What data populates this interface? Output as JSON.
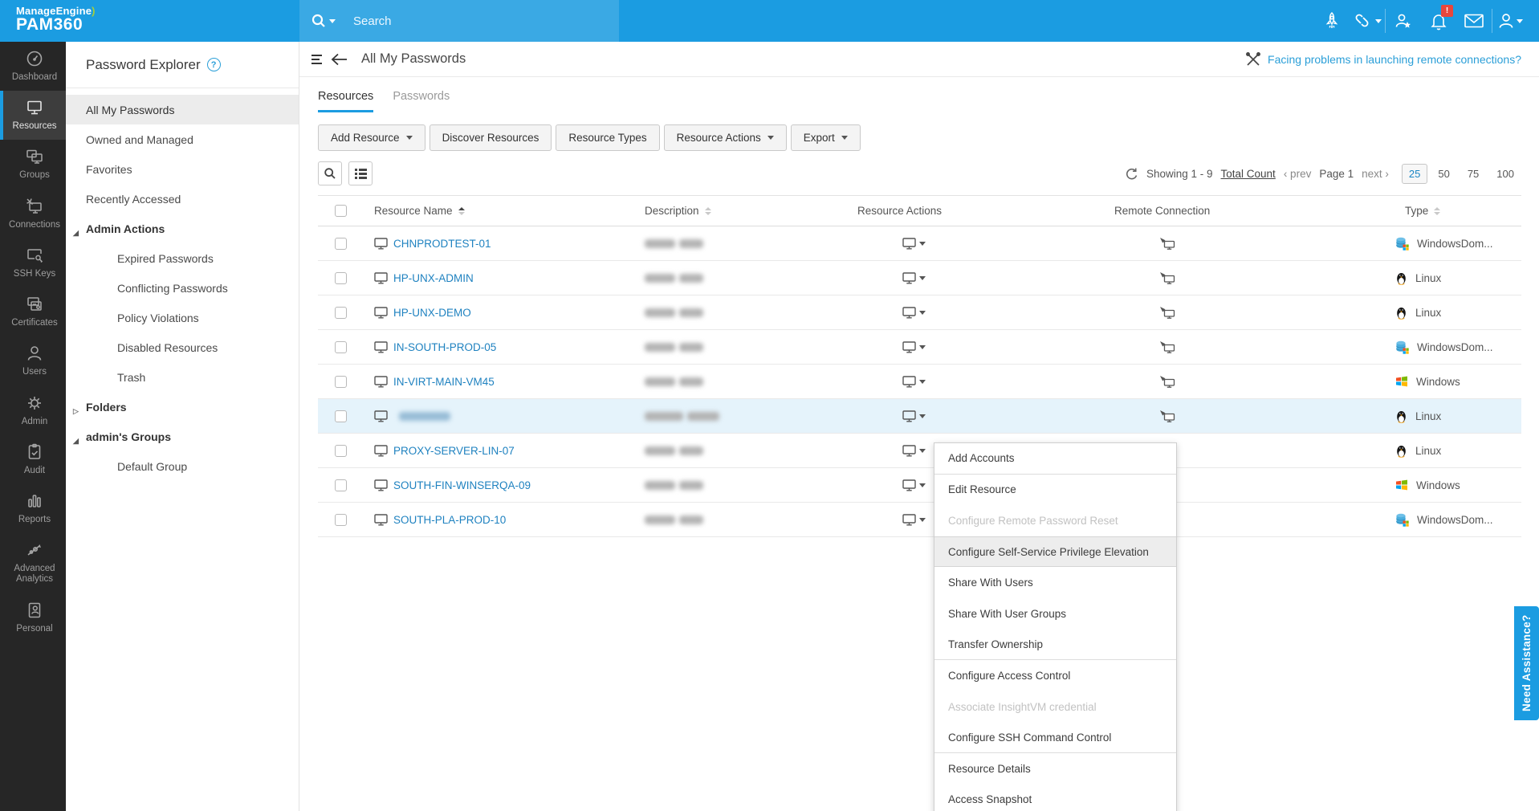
{
  "topbar": {
    "brand_line1": "ManageEngine",
    "brand_swoosh": ")",
    "brand_line2": "PAM360",
    "search_placeholder": "Search",
    "notification_badge": "!"
  },
  "sidebar": {
    "items": [
      {
        "label": "Dashboard",
        "icon": "nav-dashboard"
      },
      {
        "label": "Resources",
        "icon": "nav-resources",
        "active": true
      },
      {
        "label": "Groups",
        "icon": "nav-groups"
      },
      {
        "label": "Connections",
        "icon": "nav-connections"
      },
      {
        "label": "SSH Keys",
        "icon": "nav-sshkeys"
      },
      {
        "label": "Certificates",
        "icon": "nav-certificates"
      },
      {
        "label": "Users",
        "icon": "nav-users"
      },
      {
        "label": "Admin",
        "icon": "nav-admin"
      },
      {
        "label": "Audit",
        "icon": "nav-audit"
      },
      {
        "label": "Reports",
        "icon": "nav-reports"
      },
      {
        "label": "Advanced Analytics",
        "icon": "nav-analytics"
      },
      {
        "label": "Personal",
        "icon": "nav-personal"
      }
    ]
  },
  "explorer": {
    "title": "Password Explorer",
    "help": "?",
    "items": [
      {
        "label": "All My Passwords",
        "selected": true
      },
      {
        "label": "Owned and Managed"
      },
      {
        "label": "Favorites"
      },
      {
        "label": "Recently Accessed"
      },
      {
        "label": "Admin Actions",
        "group": true,
        "marker": "expanded"
      },
      {
        "label": "Expired Passwords",
        "indent": true
      },
      {
        "label": "Conflicting Passwords",
        "indent": true
      },
      {
        "label": "Policy Violations",
        "indent": true
      },
      {
        "label": "Disabled Resources",
        "indent": true
      },
      {
        "label": "Trash",
        "indent": true
      },
      {
        "label": "Folders",
        "group": true,
        "marker": "collapsed"
      },
      {
        "label": "admin's Groups",
        "group": true,
        "marker": "expanded"
      },
      {
        "label": "Default Group",
        "indent": true
      }
    ]
  },
  "header": {
    "title": "All My Passwords",
    "help_link": "Facing problems in launching remote connections?"
  },
  "tabs": {
    "resources": "Resources",
    "passwords": "Passwords"
  },
  "toolbar": {
    "add_resource": "Add Resource",
    "discover": "Discover Resources",
    "resource_types": "Resource Types",
    "resource_actions": "Resource Actions",
    "export": "Export"
  },
  "pagination": {
    "showing": "Showing 1 - 9",
    "total_count": "Total Count",
    "prev": "‹ prev",
    "page": "Page 1",
    "next": "next ›",
    "sizes": [
      {
        "label": "25",
        "active": true
      },
      {
        "label": "50"
      },
      {
        "label": "75"
      },
      {
        "label": "100"
      }
    ]
  },
  "table": {
    "columns": {
      "name": "Resource Name",
      "description": "Description",
      "actions": "Resource Actions",
      "remote": "Remote Connection",
      "type": "Type"
    },
    "rows": [
      {
        "name": "CHNPRODTEST-01",
        "os": "WindowsDom...",
        "os_icon": "windows-domain"
      },
      {
        "name": "HP-UNX-ADMIN",
        "os": "Linux",
        "os_icon": "linux"
      },
      {
        "name": "HP-UNX-DEMO",
        "os": "Linux",
        "os_icon": "linux"
      },
      {
        "name": "IN-SOUTH-PROD-05",
        "os": "WindowsDom...",
        "os_icon": "windows-domain"
      },
      {
        "name": "IN-VIRT-MAIN-VM45",
        "os": "Windows",
        "os_icon": "windows"
      },
      {
        "name": "",
        "os": "Linux",
        "os_icon": "linux",
        "selected": true,
        "redacted_name": true,
        "wide_desc": true
      },
      {
        "name": "PROXY-SERVER-LIN-07",
        "os": "Linux",
        "os_icon": "linux"
      },
      {
        "name": "SOUTH-FIN-WINSERQA-09",
        "os": "Windows",
        "os_icon": "windows"
      },
      {
        "name": "SOUTH-PLA-PROD-10",
        "os": "WindowsDom...",
        "os_icon": "windows-domain"
      }
    ]
  },
  "context_menu": {
    "items": [
      {
        "label": "Add Accounts",
        "sep": true
      },
      {
        "label": "Edit Resource"
      },
      {
        "label": "Configure Remote Password Reset",
        "disabled": true
      },
      {
        "label": "Configure Self-Service Privilege Elevation",
        "highlighted": true
      },
      {
        "label": "Share With Users"
      },
      {
        "label": "Share With User Groups"
      },
      {
        "label": "Transfer Ownership",
        "sep": true
      },
      {
        "label": "Configure Access Control"
      },
      {
        "label": "Associate InsightVM credential",
        "disabled": true
      },
      {
        "label": "Configure SSH Command Control",
        "sep": true
      },
      {
        "label": "Resource Details"
      },
      {
        "label": "Access Snapshot"
      }
    ]
  },
  "assist_tab": "Need Assistance?"
}
